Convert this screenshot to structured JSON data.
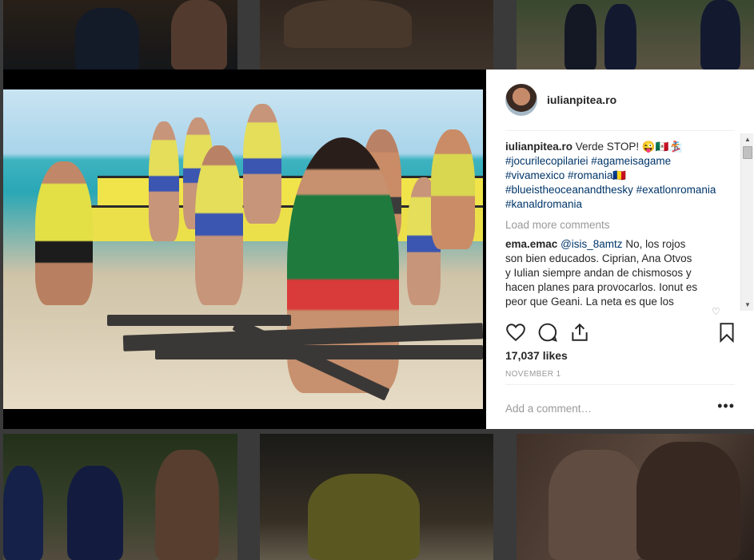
{
  "post": {
    "username": "iulianpitea.ro",
    "caption_user": "iulianpitea.ro",
    "caption_text": "Verde STOP! 😜🇲🇽🏂",
    "hashtags_1": "#jocurilecopilariei #agameisagame",
    "hashtag_vivamexico": "#vivamexico",
    "hashtag_romania": "#romania🇷🇴",
    "hashtags_2": "#blueistheoceanandthesky #exatlonromania",
    "hashtags_3": "#kanaldromania",
    "load_more": "Load more comments",
    "comment_user": "ema.emac",
    "comment_mention": "@isis_8amtz",
    "comment_text_1": " No, los rojos",
    "comment_text_2": "son bien educados. Ciprian, Ana Otvos",
    "comment_text_3": "y Iulian siempre andan de chismosos y",
    "comment_text_4": "hacen planes para provocarlos. Ionut es",
    "comment_text_5": "peor que Geani. La neta es que los",
    "likes": "17,037 likes",
    "date": "NOVEMBER 1",
    "add_comment_placeholder": "Add a comment…",
    "more": "•••"
  },
  "icons": {
    "like": "heart-icon",
    "comment": "comment-icon",
    "share": "share-icon",
    "save": "bookmark-icon",
    "options": "more-options-icon"
  },
  "colors": {
    "link": "#003569",
    "text": "#262626",
    "muted": "#999999"
  }
}
